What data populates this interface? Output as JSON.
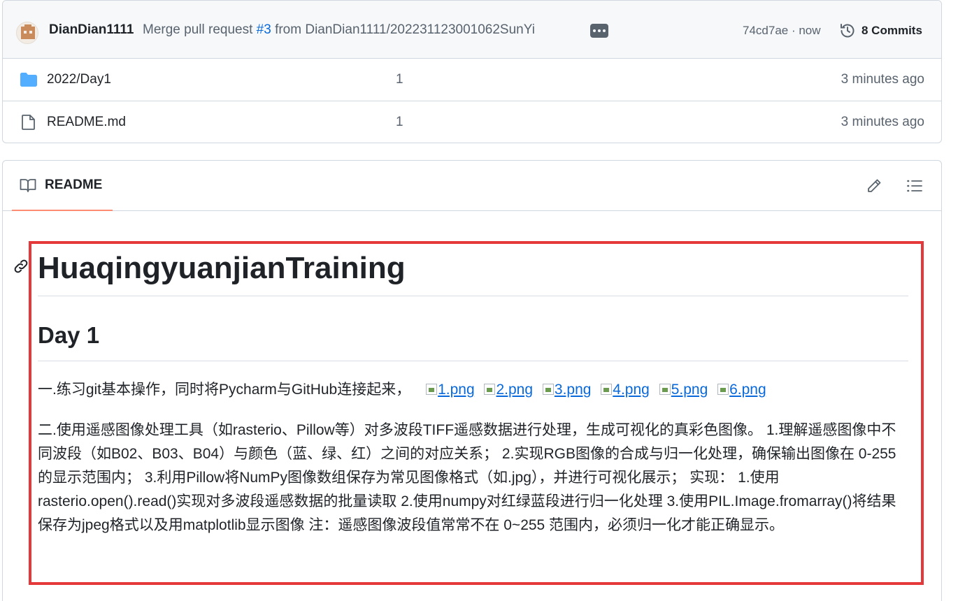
{
  "commit": {
    "author": "DianDian1111",
    "message_prefix": "Merge pull request ",
    "pr_link": "#3",
    "message_suffix": " from DianDian1111/202231123001062SunYi",
    "sha_time": "74cd7ae · now",
    "commits_label": "8 Commits"
  },
  "files": [
    {
      "name": "2022/Day1",
      "message": "1",
      "time": "3 minutes ago",
      "icon": "folder-icon"
    },
    {
      "name": "README.md",
      "message": "1",
      "time": "3 minutes ago",
      "icon": "file-icon"
    }
  ],
  "readme": {
    "tab_label": "README",
    "h1": "HuaqingyuanjianTraining",
    "h2": "Day 1",
    "p1_text": "一.练习git基本操作，同时将Pycharm与GitHub连接起来，",
    "images": [
      "1.png",
      "2.png",
      "3.png",
      "4.png",
      "5.png",
      "6.png"
    ],
    "p2_text": "二.使用遥感图像处理工具（如rasterio、Pillow等）对多波段TIFF遥感数据进行处理，生成可视化的真彩色图像。 1.理解遥感图像中不同波段（如B02、B03、B04）与颜色（蓝、绿、红）之间的对应关系； 2.实现RGB图像的合成与归一化处理，确保输出图像在 0-255 的显示范围内； 3.利用Pillow将NumPy图像数组保存为常见图像格式（如.jpg），并进行可视化展示； 实现： 1.使用rasterio.open().read()实现对多波段遥感数据的批量读取 2.使用numpy对红绿蓝段进行归一化处理 3.使用PIL.Image.fromarray()将结果保存为jpeg格式以及用matplotlib显示图像 注：遥感图像波段值常常不在 0~255 范围内，必须归一化才能正确显示。"
  },
  "colors": {
    "link": "#0969da",
    "highlight": "#e5383b",
    "tab_underline": "#fd8c73",
    "folder": "#54aeff"
  }
}
